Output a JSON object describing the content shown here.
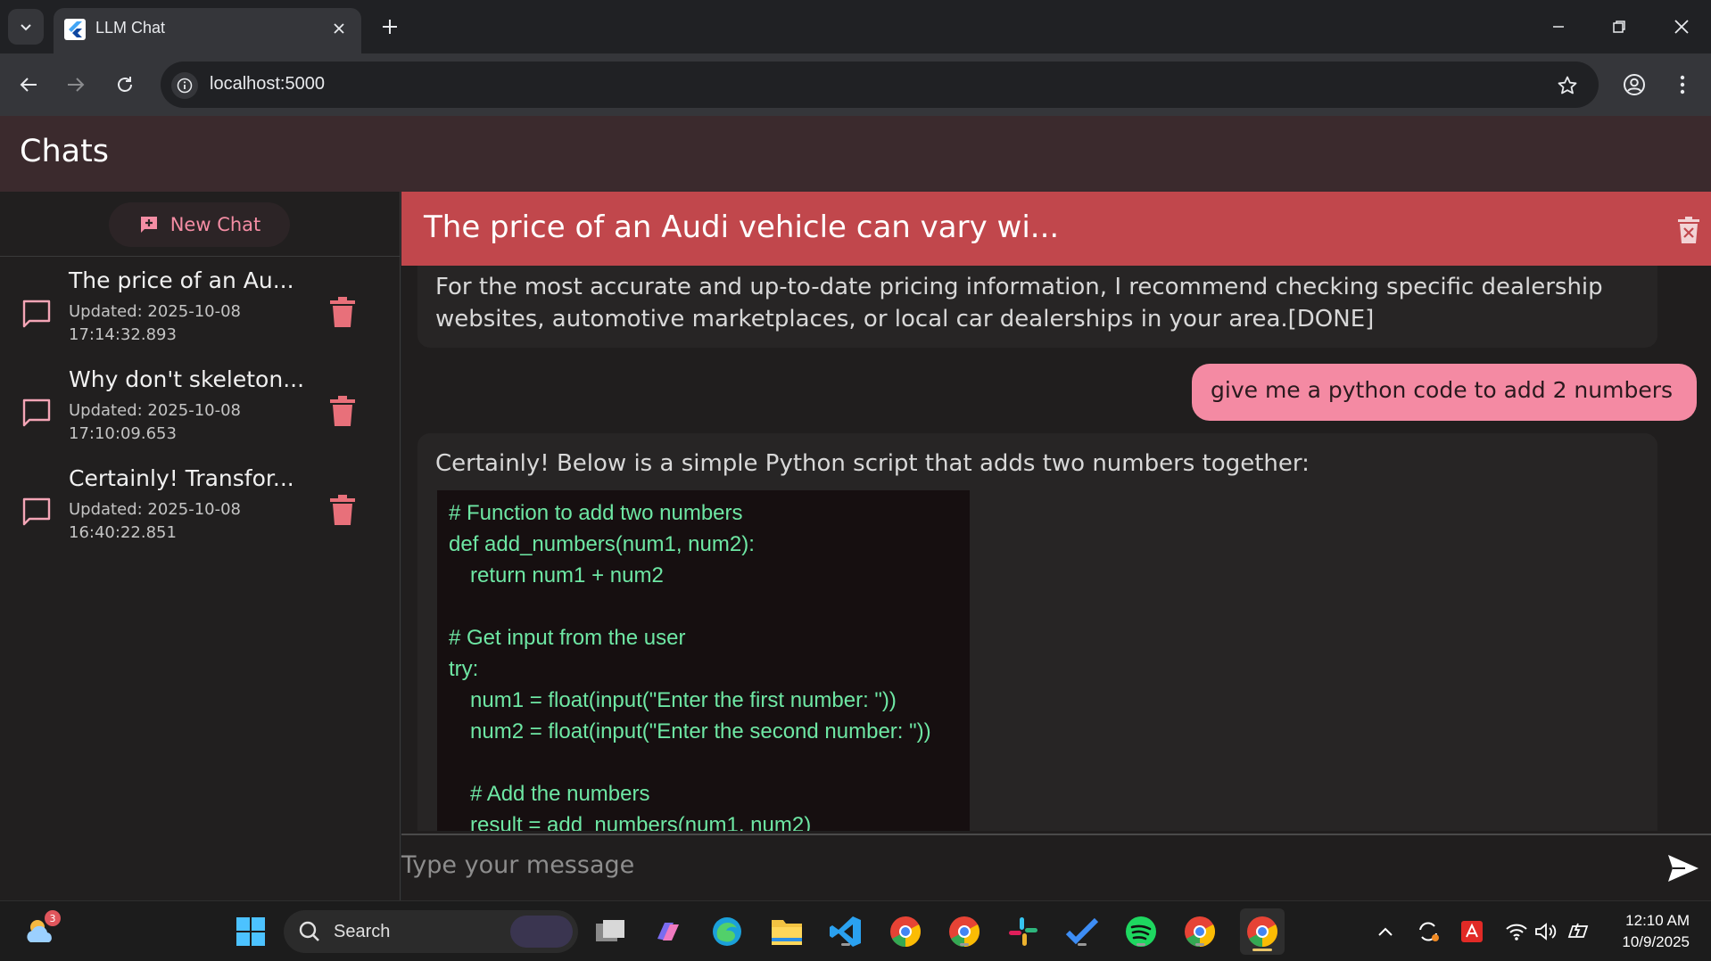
{
  "browser": {
    "tab_title": "LLM Chat",
    "url": "localhost:5000"
  },
  "app": {
    "header_title": "Chats",
    "new_chat_label": "New Chat",
    "composer_placeholder": "Type your message"
  },
  "sidebar": {
    "items": [
      {
        "title": "The price of an Au...",
        "updated_line1": "Updated: 2025-10-08",
        "updated_line2": "17:14:32.893"
      },
      {
        "title": "Why don't skeleton...",
        "updated_line1": "Updated: 2025-10-08",
        "updated_line2": "17:10:09.653"
      },
      {
        "title": "Certainly! Transfor...",
        "updated_line1": "Updated: 2025-10-08",
        "updated_line2": "16:40:22.851"
      }
    ]
  },
  "conversation": {
    "title": "The price of an Audi vehicle can vary wi...",
    "messages": [
      {
        "role": "assistant",
        "text_line1": "For the most accurate and up-to-date pricing information, I recommend checking specific dealership",
        "text_line2": "websites, automotive marketplaces, or local car dealerships in your area.[DONE]"
      },
      {
        "role": "user",
        "text": "give me a python  code to add 2 numbers"
      },
      {
        "role": "assistant",
        "text": "Certainly! Below is a simple Python script that adds two numbers together:",
        "code_lines": [
          "# Function to add two numbers",
          "def add_numbers(num1, num2):",
          "    return num1 + num2",
          "",
          "# Get input from the user",
          "try:",
          "    num1 = float(input(\"Enter the first number: \"))",
          "    num2 = float(input(\"Enter the second number: \"))",
          "",
          "    # Add the numbers",
          "    result = add_numbers(num1, num2)"
        ]
      }
    ]
  },
  "taskbar": {
    "search_label": "Search",
    "weather_badge": "3",
    "time": "12:10 AM",
    "date": "10/9/2025"
  },
  "colors": {
    "accent_pink": "#f48aa3",
    "title_bar_red": "#c1474c",
    "code_green": "#6ee7a4",
    "delete_red": "#e8707a"
  }
}
